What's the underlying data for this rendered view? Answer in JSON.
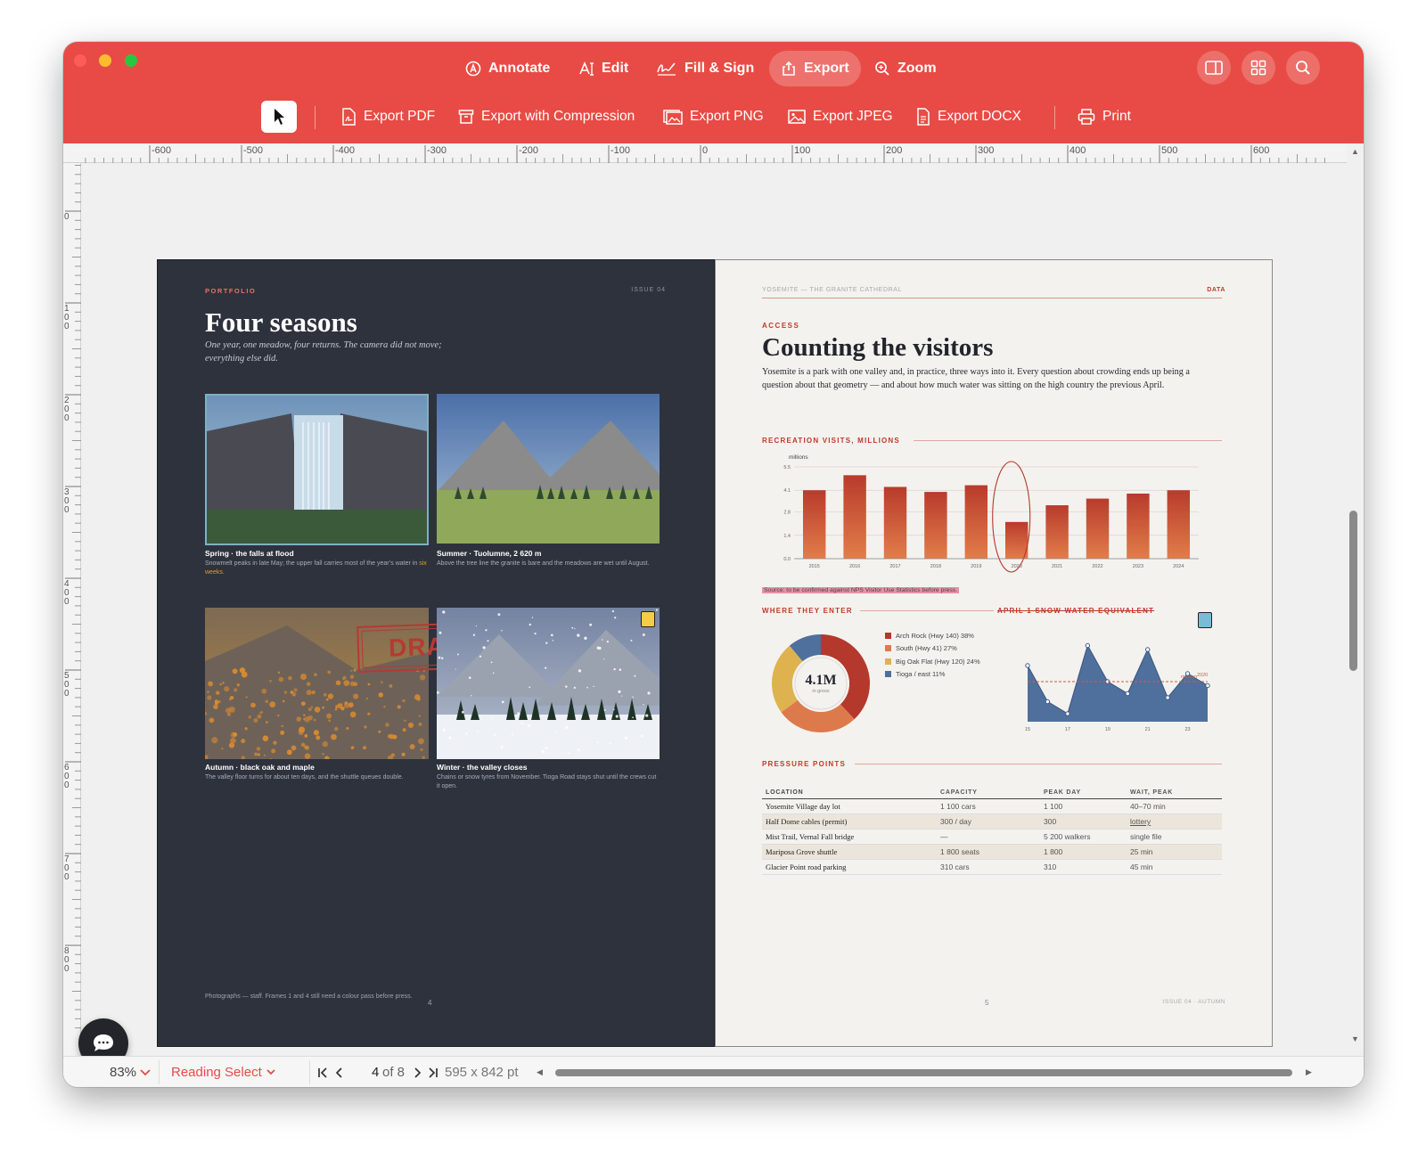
{
  "toolbar": {
    "tabs": [
      "Annotate",
      "Edit",
      "Fill & Sign",
      "Export",
      "Zoom"
    ],
    "sub": [
      "Export PDF",
      "Export with Compression",
      "Export PNG",
      "Export JPEG",
      "Export DOCX",
      "Print"
    ]
  },
  "ruler": {
    "h": [
      "-600",
      "-500",
      "-400",
      "-300",
      "-200",
      "-100",
      "0",
      "100",
      "200",
      "300",
      "400",
      "500",
      "600"
    ],
    "v": [
      "0",
      "100",
      "200",
      "300",
      "400",
      "500",
      "600",
      "700",
      "800"
    ]
  },
  "left_page": {
    "kicker": "PORTFOLIO",
    "issue": "ISSUE 04",
    "title": "Four seasons",
    "subtitle": "One year, one meadow, four returns. The camera did not move; everything else did.",
    "photos": [
      {
        "caption": "Spring · the falls at flood",
        "desc": "Snowmelt peaks in late May; the upper fall carries most of the year’s water in",
        "desc_highlight": "six weeks."
      },
      {
        "caption": "Summer · Tuolumne, 2 620 m",
        "desc": "Above the tree line the granite is bare and the meadows are wet until August."
      },
      {
        "caption": "Autumn · black oak and maple",
        "desc": "The valley floor turns for about ten days, and the shuttle queues double."
      },
      {
        "caption": "Winter · the valley closes",
        "desc": "Chains or snow tyres from November. Tioga Road stays shut until the crews cut it open."
      }
    ],
    "stamp": "DRAFT",
    "footer": "Photographs — staff. Frames 1 and 4 still need a colour pass before press.",
    "page_num": "4"
  },
  "right_page": {
    "running_head": "YOSEMITE — THE GRANITE CATHEDRAL",
    "section": "DATA",
    "kicker": "ACCESS",
    "title": "Counting the visitors",
    "body": "Yosemite is a park with one valley and, in practice, three ways into it. Every question about crowding ends up being a question about that geometry — and about how much water was sitting on the high country the previous April.",
    "chart1_heading": "RECREATION VISITS, MILLIONS",
    "chart1_unit": "millions",
    "source_note": "Source: to be confirmed against NPS Visitor Use Statistics before press.",
    "chart2_heading": "WHERE THEY ENTER",
    "donut_center": "4.1M",
    "donut_sub": "in gross",
    "chart3_heading": "APRIL 1 SNOW WATER EQUIVALENT",
    "chart3_median": "median",
    "chart3_year": "2020",
    "table_heading": "PRESSURE POINTS",
    "table_cols": [
      "LOCATION",
      "CAPACITY",
      "PEAK DAY",
      "WAIT, PEAK"
    ],
    "table_rows": [
      [
        "Yosemite Village day lot",
        "1 100 cars",
        "1 100",
        "40–70 min"
      ],
      [
        "Half Dome cables (permit)",
        "300 / day",
        "300",
        "lottery"
      ],
      [
        "Mist Trail, Vernal Fall bridge",
        "—",
        "5 200 walkers",
        "single file"
      ],
      [
        "Mariposa Grove shuttle",
        "1 800 seats",
        "1 800",
        "25 min"
      ],
      [
        "Glacier Point road parking",
        "310 cars",
        "310",
        "45 min"
      ]
    ],
    "page_num": "5",
    "footer": "ISSUE 04 · AUTUMN"
  },
  "page_labels": [
    "4",
    "5"
  ],
  "chart_data": [
    {
      "type": "bar",
      "title": "RECREATION VISITS, MILLIONS",
      "ylabel": "millions",
      "categories": [
        "2015",
        "2016",
        "2017",
        "2018",
        "2019",
        "2020",
        "2021",
        "2022",
        "2023",
        "2024"
      ],
      "values": [
        4.1,
        5.0,
        4.3,
        4.0,
        4.4,
        2.2,
        3.2,
        3.6,
        3.9,
        4.1
      ],
      "yticks": [
        "0.0",
        "1.4",
        "2.8",
        "4.1",
        "5.5"
      ],
      "ylim": [
        0,
        5.5
      ],
      "highlight": "2020"
    },
    {
      "type": "pie",
      "title": "WHERE THEY ENTER",
      "series": [
        {
          "name": "Arch Rock (Hwy 140)",
          "value": 38,
          "label": "38%",
          "color": "#b5382c"
        },
        {
          "name": "South (Hwy 41)",
          "value": 27,
          "label": "27%",
          "color": "#dd7a4c"
        },
        {
          "name": "Big Oak Flat (Hwy 120)",
          "value": 24,
          "label": "24%",
          "color": "#deb24f"
        },
        {
          "name": "Tioga / east",
          "value": 11,
          "label": "11%",
          "color": "#4f709c"
        }
      ]
    },
    {
      "type": "area",
      "title": "APRIL 1 SNOW WATER EQUIVALENT",
      "x": [
        15,
        16,
        17,
        18,
        19,
        20,
        21,
        22,
        23,
        24
      ],
      "xticks": [
        "15",
        "17",
        "19",
        "21",
        "23"
      ],
      "values": [
        0.7,
        0.25,
        0.1,
        0.95,
        0.5,
        0.35,
        0.9,
        0.3,
        0.6,
        0.45
      ],
      "median": 0.5
    }
  ],
  "status": {
    "zoom": "83%",
    "mode": "Reading Select",
    "page_current": "4",
    "page_of": "of 8",
    "size": "595 x 842 pt"
  }
}
